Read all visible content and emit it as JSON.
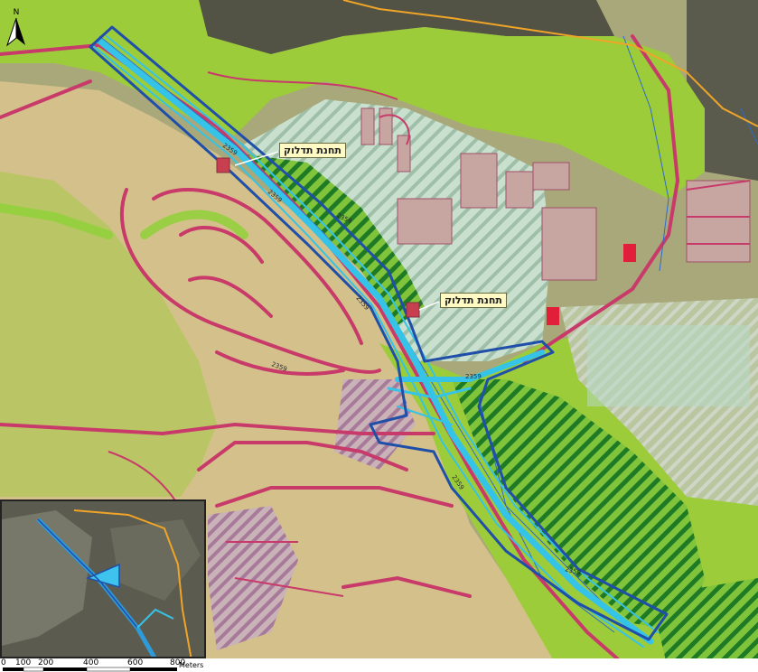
{
  "labels": {
    "station_upper": "תחנת תדלוק",
    "station_lower": "תחנת תדלוק",
    "north": "N"
  },
  "scale": {
    "ticks": [
      "0",
      "100",
      "200",
      "400",
      "600",
      "800"
    ],
    "unit": "Meters"
  },
  "road_labels": [
    "2359",
    "2359",
    "2359",
    "2359",
    "2359",
    "2359",
    "2359",
    "2359"
  ],
  "colors": {
    "residential": "#d4c08a",
    "green": "#9ccc3a",
    "road": "#c83a6a",
    "plan_boundary": "#1f4fa8",
    "route": "#36c3e8",
    "hatch_green": "#1f8a2a",
    "hatch_light": "#b8d8c4"
  }
}
